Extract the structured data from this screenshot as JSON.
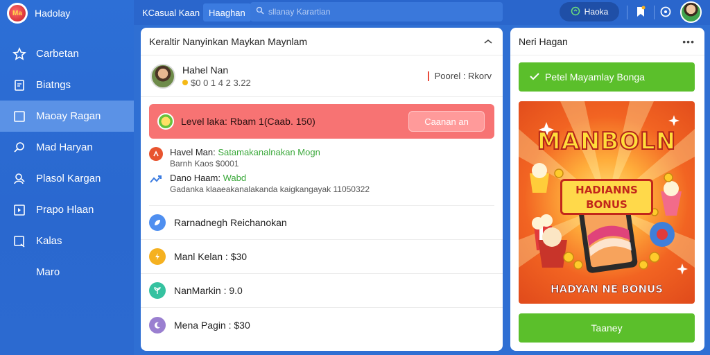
{
  "brand": {
    "name": "Hadolay",
    "logo_text": "Ma"
  },
  "sidebar": {
    "items": [
      {
        "label": "Carbetan",
        "icon": "star-icon",
        "active": false
      },
      {
        "label": "Biatngs",
        "icon": "document-icon",
        "active": false
      },
      {
        "label": "Maoay Ragan",
        "icon": "square-icon",
        "active": true
      },
      {
        "label": "Mad Haryan",
        "icon": "search-icon",
        "active": false
      },
      {
        "label": "Plasol Kargan",
        "icon": "people-icon",
        "active": false
      },
      {
        "label": "Prapo Hlaan",
        "icon": "play-square-icon",
        "active": false
      },
      {
        "label": "Kalas",
        "icon": "checkbox-icon",
        "active": false
      },
      {
        "label": "Maro",
        "icon": "",
        "active": false
      }
    ]
  },
  "topbar": {
    "tab1": "KCasual Kaan",
    "tab2": "Haaghan",
    "search_placeholder": "sllanay Karartian",
    "pill_label": "Haoka"
  },
  "main": {
    "title": "Keraltir Nanyinkan Maykan Maynlam",
    "profile": {
      "name": "Hahel Nan",
      "coins": "$0 0 1 4 2 3.22",
      "link": "Poorel : Rkorv"
    },
    "level": {
      "text": "Level laka: Rbam 1(Caab. 150)",
      "button": "Caanan an"
    },
    "feed": {
      "item1_title": "Havel Man:",
      "item1_highlight": "Satamakanalnakan Mogn",
      "item1_sub": "Barnh Kaos $0001",
      "item2_title": "Dano Haam:",
      "item2_highlight": "Wabd",
      "item2_sub": "Gadanka klaaeakanalakanda kaigkangayak 11050322"
    },
    "list": [
      {
        "label": "Rarnadnegh Reichanokan",
        "icon": "leaf-icon",
        "color": "#4f8ff0"
      },
      {
        "label": "Manl Kelan : $30",
        "icon": "lightning-icon",
        "color": "#f5b120"
      },
      {
        "label": "NanMarkin : 9.0",
        "icon": "plant-icon",
        "color": "#35c2a0"
      },
      {
        "label": "Mena Pagin : $30",
        "icon": "moon-icon",
        "color": "#9a7fd0"
      }
    ]
  },
  "right": {
    "title": "Neri Hagan",
    "top_button": "Petel Mayamlay Bonga",
    "promo": {
      "title": "MANBOLN",
      "badge_line1": "HADIANNS",
      "badge_line2": "BONUS",
      "footer": "HADYAN NE BONUS"
    },
    "bottom_button": "Taaney"
  }
}
